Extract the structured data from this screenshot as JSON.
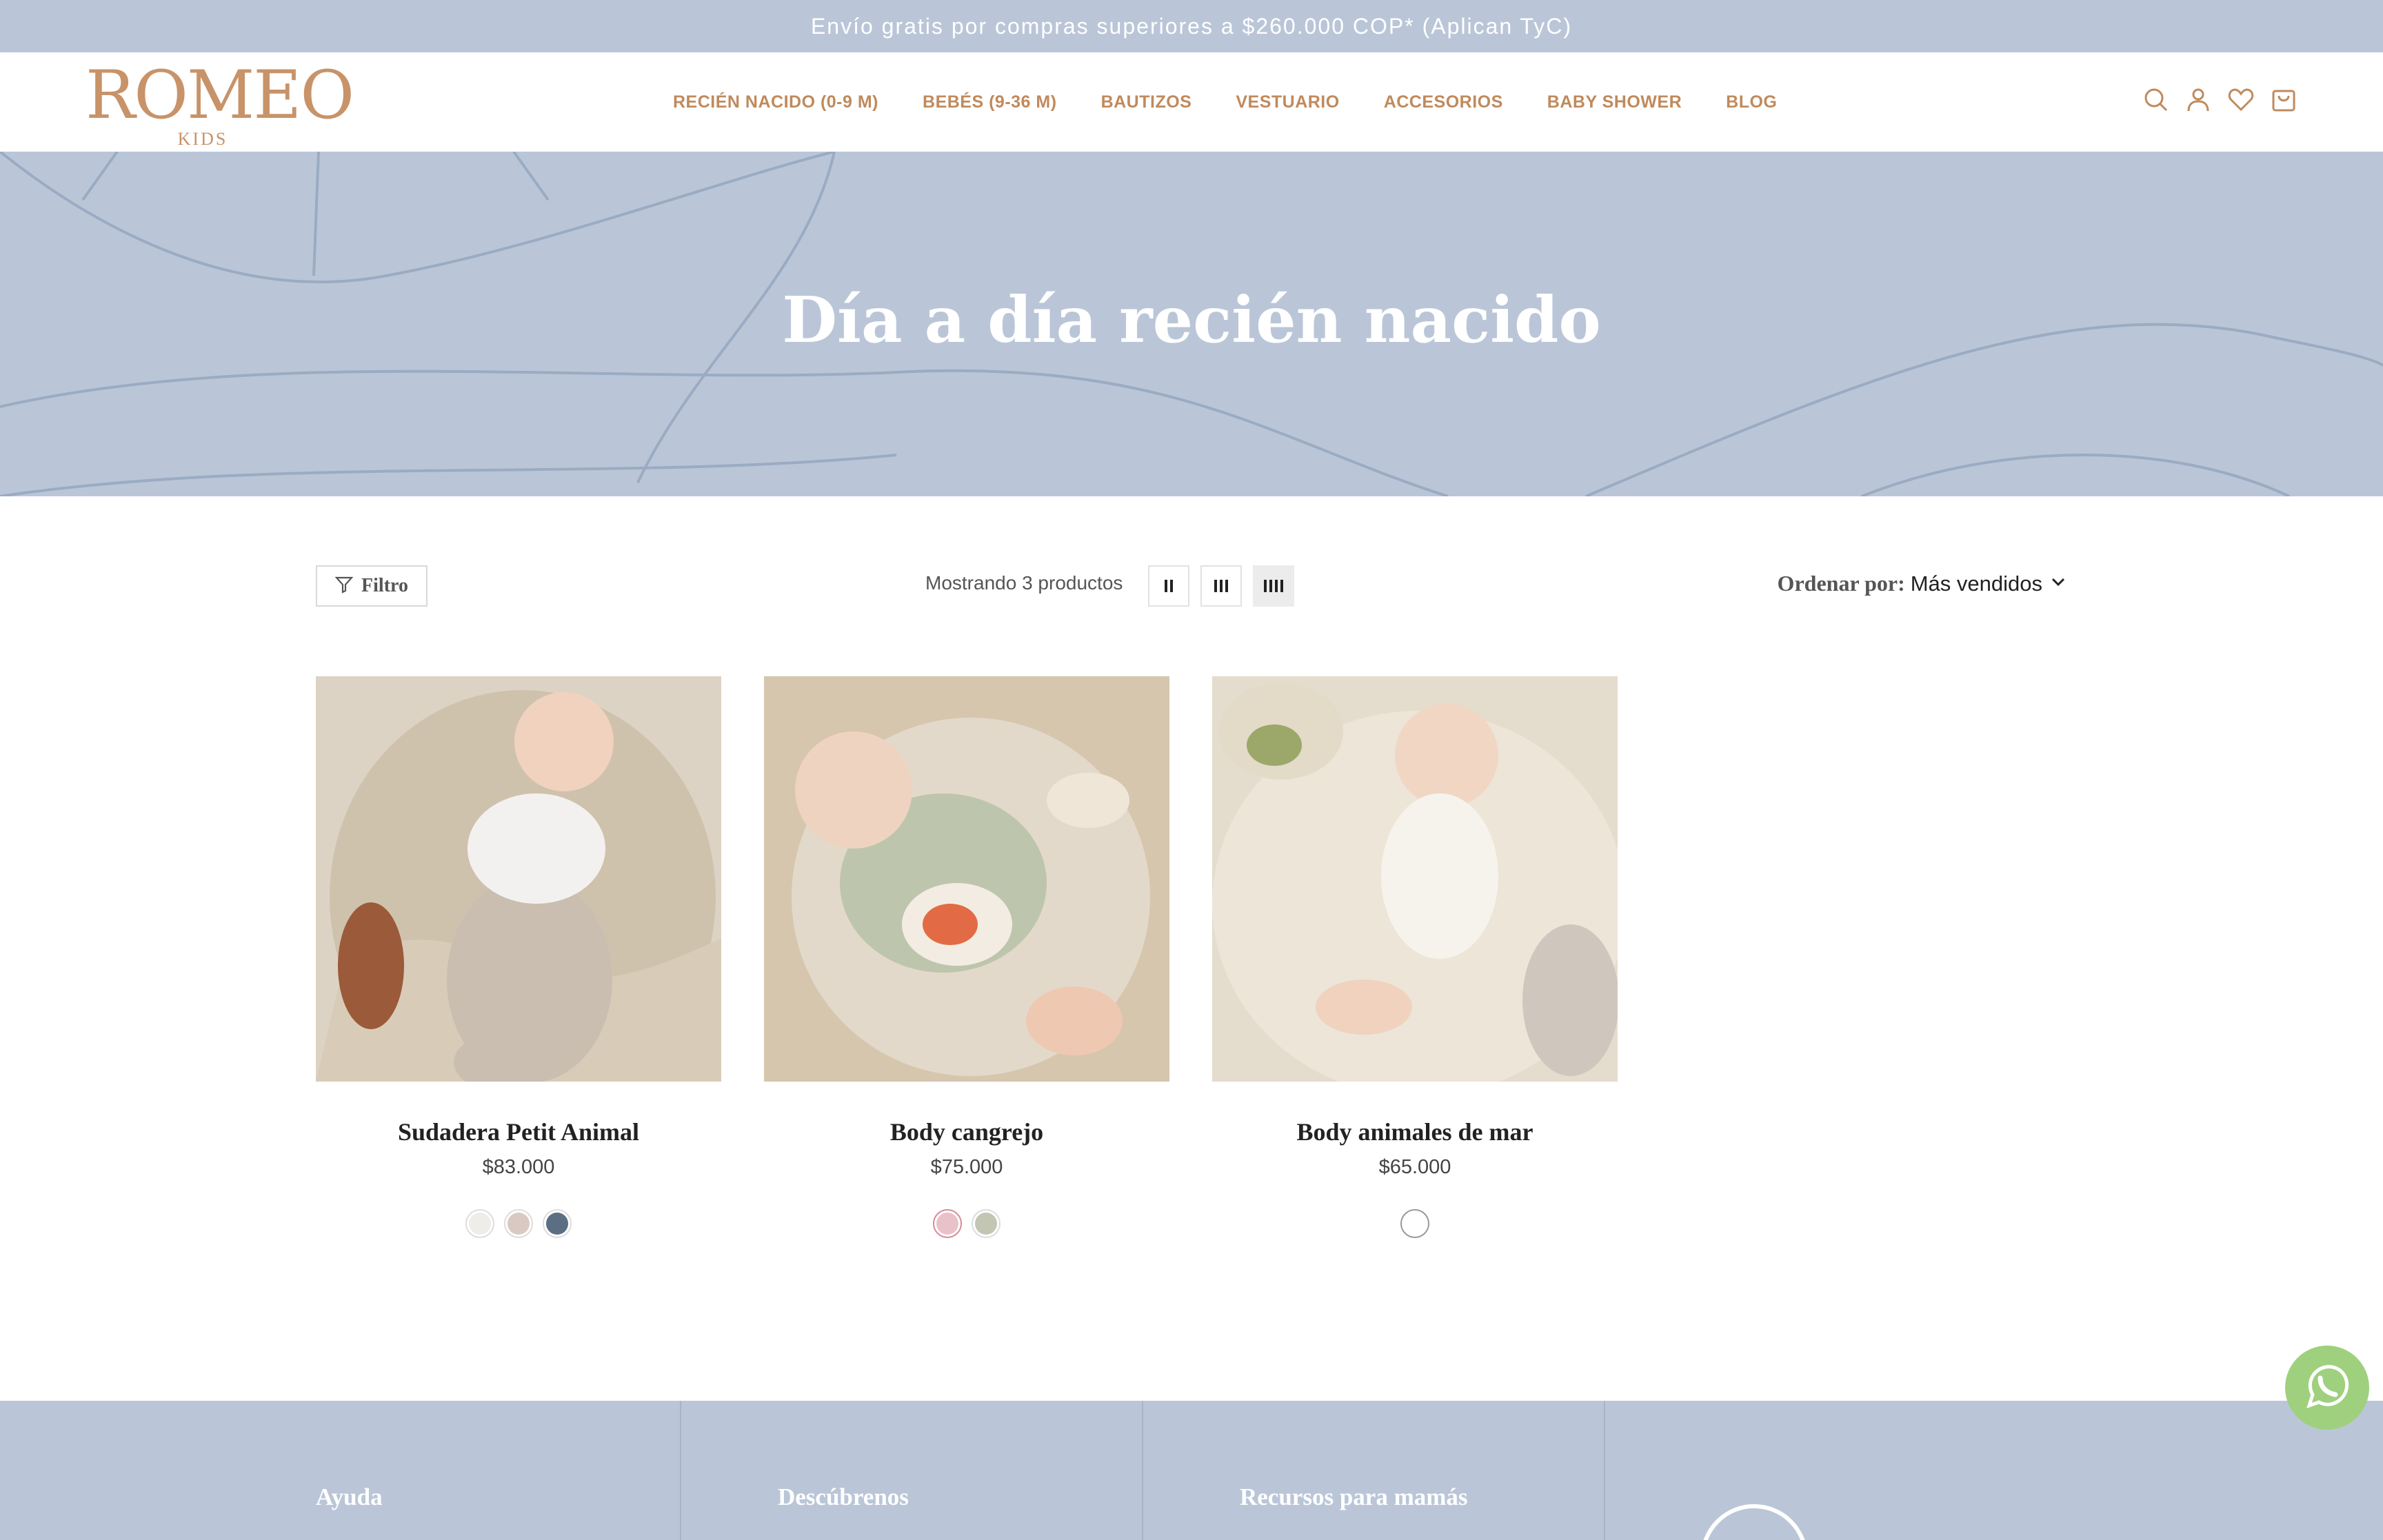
{
  "announcement": {
    "text": "Envío gratis por compras superiores a $260.000 COP* (Aplican TyC)"
  },
  "header": {
    "logo_main": "ROMEO",
    "logo_sub": "KIDS",
    "nav": [
      {
        "label": "RECIÉN NACIDO (0-9 M)"
      },
      {
        "label": "BEBÉS (9-36 M)"
      },
      {
        "label": "BAUTIZOS"
      },
      {
        "label": "VESTUARIO"
      },
      {
        "label": "ACCESORIOS"
      },
      {
        "label": "BABY SHOWER"
      },
      {
        "label": "BLOG"
      }
    ],
    "icons": [
      "search-icon",
      "user-icon",
      "heart-icon",
      "cart-icon"
    ]
  },
  "hero": {
    "title": "Día a día recién nacido"
  },
  "toolbar": {
    "filter_label": "Filtro",
    "showing_text": "Mostrando 3 productos",
    "view_modes": [
      "2-columns",
      "3-columns",
      "4-columns"
    ],
    "active_view": "4-columns",
    "sort_label": "Ordenar por:",
    "sort_value": "Más vendidos"
  },
  "products": [
    {
      "name": "Sudadera Petit Animal",
      "price": "$83.000",
      "swatches": [
        "#efede8",
        "#dac9c3",
        "#5c6e82"
      ]
    },
    {
      "name": "Body cangrejo",
      "price": "$75.000",
      "swatches": [
        "#e9c2c9",
        "#c4c6b4"
      ],
      "selected_swatch": 0
    },
    {
      "name": "Body animales de mar",
      "price": "$65.000",
      "swatches": [
        "#ffffff"
      ]
    }
  ],
  "footer": {
    "columns": [
      {
        "title": "Ayuda"
      },
      {
        "title": "Descúbrenos"
      },
      {
        "title": "Recursos para mamás"
      }
    ]
  },
  "colors": {
    "brand": "#c89369",
    "nav": "#c08a5c",
    "hero_bg": "#bac6d8",
    "whatsapp": "#9fd07e"
  }
}
